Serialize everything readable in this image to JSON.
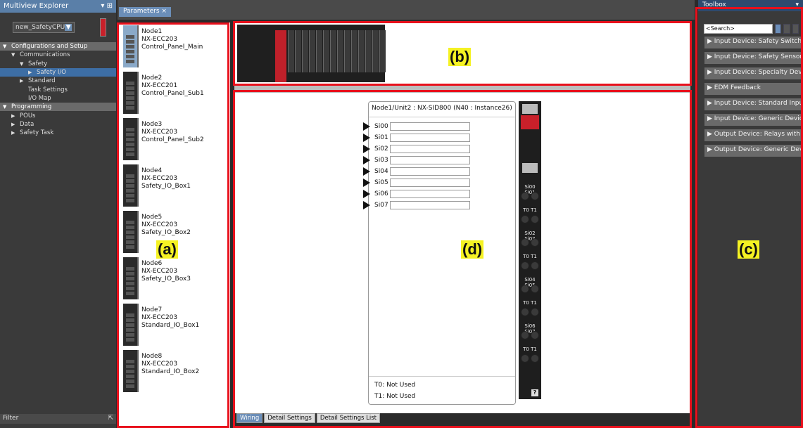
{
  "explorer": {
    "title": "Multiview Explorer",
    "pin_glyph": "▾ ⊞",
    "device": "new_SafetyCPU",
    "dropdown_glyph": "▼",
    "tree": [
      {
        "label": "Configurations and Setup",
        "level": 0,
        "section": true,
        "icon": "▼"
      },
      {
        "label": "Communications",
        "level": 1,
        "icon": "▼"
      },
      {
        "label": "Safety",
        "level": 2,
        "icon": "▼"
      },
      {
        "label": "Safety I/O",
        "level": 3,
        "icon": "▶",
        "selected": true
      },
      {
        "label": "Standard",
        "level": 2,
        "icon": "▶"
      },
      {
        "label": "Task Settings",
        "level": 2,
        "icon": ""
      },
      {
        "label": "I/O Map",
        "level": 2,
        "icon": ""
      },
      {
        "label": "Programming",
        "level": 0,
        "section": true,
        "icon": "▼"
      },
      {
        "label": "POUs",
        "level": 1,
        "icon": "▶"
      },
      {
        "label": "Data",
        "level": 1,
        "icon": "▶"
      },
      {
        "label": "Safety Task",
        "level": 1,
        "icon": "▶"
      }
    ],
    "filter_label": "Filter"
  },
  "tab": {
    "label": "Parameters",
    "close": "×"
  },
  "nodes": [
    {
      "name": "Node1",
      "model": "NX-ECC203",
      "desc": "Control_Panel_Main",
      "light": true
    },
    {
      "name": "Node2",
      "model": "NX-ECC201",
      "desc": "Control_Panel_Sub1"
    },
    {
      "name": "Node3",
      "model": "NX-ECC203",
      "desc": "Control_Panel_Sub2"
    },
    {
      "name": "Node4",
      "model": "NX-ECC203",
      "desc": "Safety_IO_Box1"
    },
    {
      "name": "Node5",
      "model": "NX-ECC203",
      "desc": "Safety_IO_Box2"
    },
    {
      "name": "Node6",
      "model": "NX-ECC203",
      "desc": "Safety_IO_Box3"
    },
    {
      "name": "Node7",
      "model": "NX-ECC203",
      "desc": "Standard_IO_Box1"
    },
    {
      "name": "Node8",
      "model": "NX-ECC203",
      "desc": "Standard_IO_Box2"
    }
  ],
  "unit": {
    "title": "Node1/Unit2 : NX-SID800 (N40 : Instance26)",
    "inputs": [
      "Si00",
      "Si01",
      "Si02",
      "Si03",
      "Si04",
      "Si05",
      "Si06",
      "Si07"
    ],
    "footer": [
      "T0: Not Used",
      "T1: Not Used"
    ]
  },
  "terminal": {
    "pairs": [
      [
        "Si00",
        "Si01"
      ],
      [
        "T0",
        "T1"
      ],
      [
        "Si02",
        "Si03"
      ],
      [
        "T0",
        "T1"
      ],
      [
        "Si04",
        "Si05"
      ],
      [
        "T0",
        "T1"
      ],
      [
        "Si06",
        "Si07"
      ],
      [
        "T0",
        "T1"
      ]
    ],
    "help": "?"
  },
  "bottom_tabs": [
    "Wiring",
    "Detail Settings",
    "Detail Settings List"
  ],
  "toolbox": {
    "title": "Toolbox",
    "search_placeholder": "<Search>",
    "items": [
      "Input Device: Safety Switches",
      "Input Device: Safety Sensors",
      "Input Device: Specialty Devices",
      "EDM Feedback",
      "Input Device: Standard Input",
      "Input Device: Generic Device",
      "Output Device: Relays with",
      "Output Device: Generic Device"
    ]
  },
  "annotations": {
    "a": "(a)",
    "b": "(b)",
    "c": "(c)",
    "d": "(d)"
  },
  "colors": {
    "frame": "#e8101c",
    "badge": "#f5f223",
    "accent": "#6b8eb8"
  }
}
